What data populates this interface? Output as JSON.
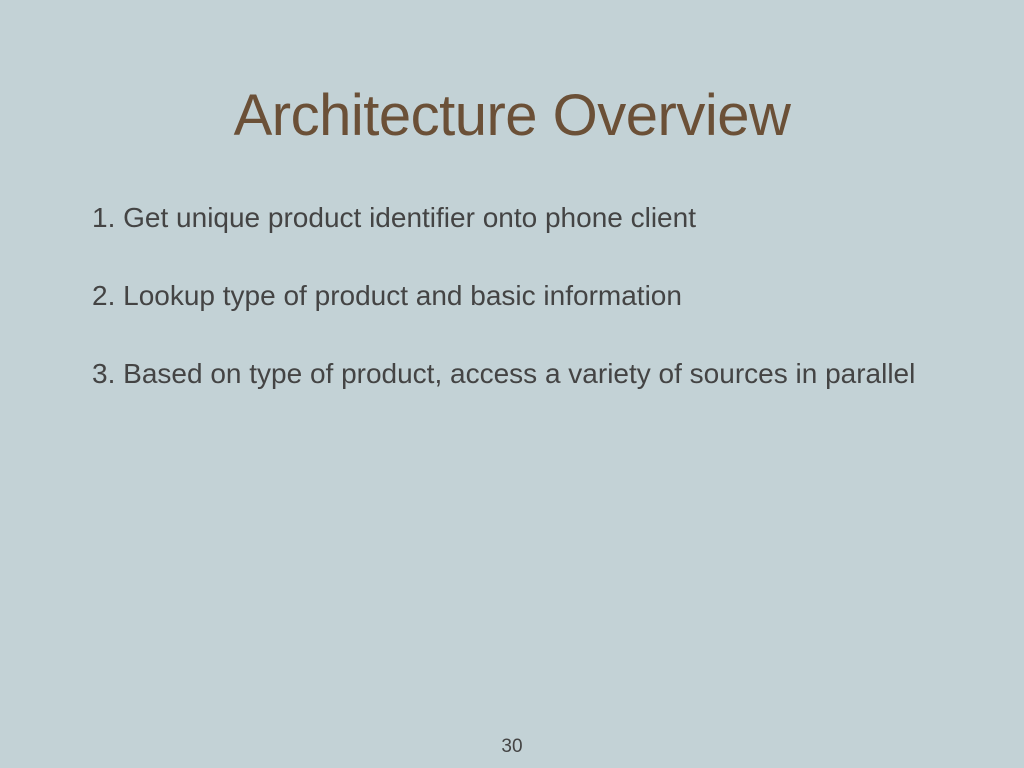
{
  "title": "Architecture Overview",
  "items": [
    {
      "number": "1.",
      "text": "Get unique product identifier onto phone client"
    },
    {
      "number": "2.",
      "text": "Lookup type of product and basic information"
    },
    {
      "number": "3.",
      "text": "Based on type of product, access a variety of sources in parallel"
    }
  ],
  "pageNumber": "30"
}
